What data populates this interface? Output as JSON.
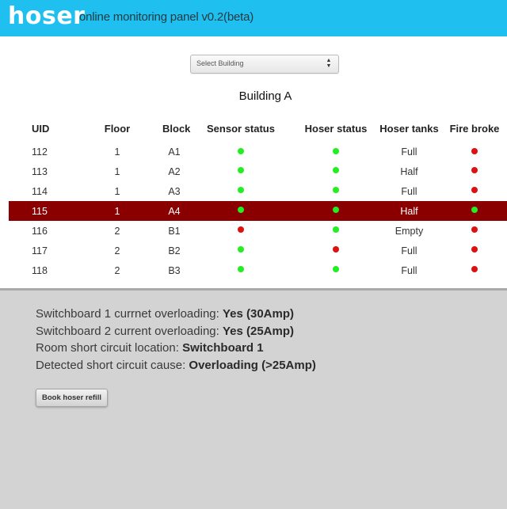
{
  "header": {
    "logo": "hoser",
    "subtitle": "online monitoring panel v0.2(beta)",
    "bg_color": "#1fc0ef"
  },
  "building_select": {
    "value": "Select Building"
  },
  "building_title": "Building A",
  "table": {
    "headers": [
      "UID",
      "Floor",
      "Block",
      "Sensor status",
      "Hoser status",
      "Hoser tanks",
      "Fire broke"
    ],
    "rows": [
      {
        "uid": "112",
        "floor": "1",
        "block": "A1",
        "sensor": "green",
        "hoser": "green",
        "tanks": "Full",
        "fire": "red"
      },
      {
        "uid": "113",
        "floor": "1",
        "block": "A2",
        "sensor": "green",
        "hoser": "green",
        "tanks": "Half",
        "fire": "red"
      },
      {
        "uid": "114",
        "floor": "1",
        "block": "A3",
        "sensor": "green",
        "hoser": "green",
        "tanks": "Full",
        "fire": "red"
      },
      {
        "uid": "115",
        "floor": "1",
        "block": "A4",
        "sensor": "green",
        "hoser": "green",
        "tanks": "Half",
        "fire": "green",
        "selected": true
      },
      {
        "uid": "116",
        "floor": "2",
        "block": "B1",
        "sensor": "red",
        "hoser": "green",
        "tanks": "Empty",
        "fire": "red"
      },
      {
        "uid": "117",
        "floor": "2",
        "block": "B2",
        "sensor": "green",
        "hoser": "red",
        "tanks": "Full",
        "fire": "red"
      },
      {
        "uid": "118",
        "floor": "2",
        "block": "B3",
        "sensor": "green",
        "hoser": "green",
        "tanks": "Full",
        "fire": "red"
      }
    ],
    "selected_row_color": "#8a0000",
    "status_colors": {
      "green": "#22ee22",
      "red": "#dd1111"
    }
  },
  "info": {
    "lines": [
      {
        "label": "Switchboard 1 currnet overloading: ",
        "value": "Yes (30Amp)"
      },
      {
        "label": "Switchboard 2 current overloading: ",
        "value": "Yes (25Amp)"
      },
      {
        "label": "Room short circuit location: ",
        "value": "Switchboard 1"
      },
      {
        "label": "Detected short circuit cause: ",
        "value": "Overloading (>25Amp)"
      }
    ]
  },
  "book_button": {
    "label": "Book hoser refill"
  }
}
